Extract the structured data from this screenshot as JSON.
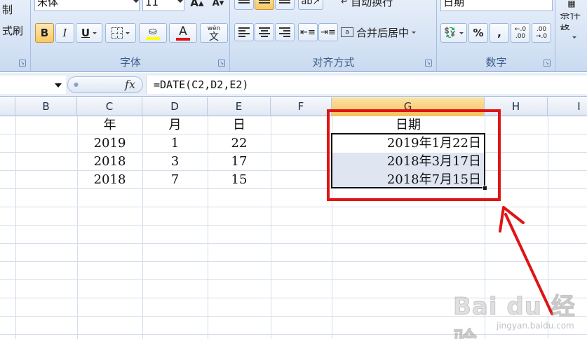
{
  "ribbon": {
    "clipboard": {
      "copy_label": "制",
      "format_painter_label": "式刷"
    },
    "font": {
      "font_name": "宋体",
      "font_size": "11",
      "bold": "B",
      "italic": "I",
      "underline": "U",
      "font_color_glyph": "A",
      "phonetic_glyph": "wén",
      "phonetic_char": "文",
      "group_label": "字体"
    },
    "alignment": {
      "wrap_text_label": "自动换行",
      "merge_center_label": "合并后居中",
      "group_label": "对齐方式"
    },
    "number": {
      "format_value": "日期",
      "percent": "%",
      "comma": ",",
      "increase_decimal_top": "←.0",
      "increase_decimal_bottom": ".00",
      "decrease_decimal_top": ".00",
      "decrease_decimal_bottom": "→.0",
      "group_label": "数字"
    },
    "styles": {
      "conditional_format_label": "条件格"
    }
  },
  "formula_bar": {
    "fx": "fx",
    "formula": "=DATE(C2,D2,E2)"
  },
  "columns": [
    "B",
    "C",
    "D",
    "E",
    "F",
    "G",
    "H",
    "I"
  ],
  "selected_column": "G",
  "rows": [
    {
      "c": "年",
      "d": "月",
      "e": "日",
      "g": "日期"
    },
    {
      "c": "2019",
      "d": "1",
      "e": "22",
      "g": "2019年1月22日"
    },
    {
      "c": "2018",
      "d": "3",
      "e": "17",
      "g": "2018年3月17日"
    },
    {
      "c": "2018",
      "d": "7",
      "e": "15",
      "g": "2018年7月15日"
    }
  ],
  "watermark": {
    "logo": "Bai du 经验",
    "url": "jingyan.baidu.com"
  },
  "colors": {
    "annotation": "#e01414",
    "selected_header": "#f5c25d",
    "selection_fill": "#dfe6f2",
    "font_color_bar": "#e01414",
    "highlight_bar": "#ffff00"
  }
}
